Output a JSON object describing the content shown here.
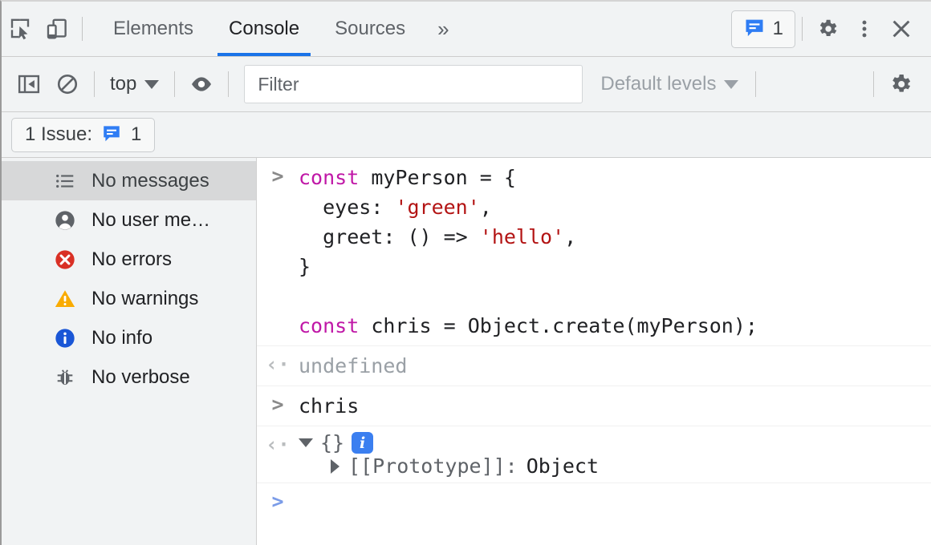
{
  "tabbar": {
    "inspect_icon": "inspect-cursor-icon",
    "device_icon": "device-toolbar-icon",
    "tabs": [
      {
        "label": "Elements",
        "active": false
      },
      {
        "label": "Console",
        "active": true
      },
      {
        "label": "Sources",
        "active": false
      }
    ],
    "more_tabs_label": "»",
    "issues_count": "1",
    "settings_icon": "gear-icon",
    "more_options_icon": "kebab-menu-icon",
    "close_icon": "close-icon"
  },
  "console_toolbar": {
    "sidebar_toggle_icon": "show-console-sidebar-icon",
    "clear_icon": "clear-console-icon",
    "context_label": "top",
    "eye_icon": "live-expressions-eye-icon",
    "filter_placeholder": "Filter",
    "filter_value": "",
    "levels_label": "Default levels",
    "settings_icon": "console-settings-gear-icon"
  },
  "issues_strip": {
    "label": "1 Issue:",
    "count": "1"
  },
  "sidebar": {
    "items": [
      {
        "label": "No messages",
        "icon": "list-icon",
        "selected": true
      },
      {
        "label": "No user me…",
        "icon": "user-icon",
        "selected": false
      },
      {
        "label": "No errors",
        "icon": "error-icon",
        "selected": false
      },
      {
        "label": "No warnings",
        "icon": "warning-icon",
        "selected": false
      },
      {
        "label": "No info",
        "icon": "info-icon",
        "selected": false
      },
      {
        "label": "No verbose",
        "icon": "verbose-bug-icon",
        "selected": false
      }
    ]
  },
  "console": {
    "input_marker": ">",
    "output_marker": "‹·",
    "entry1": {
      "line1_kw": "const",
      "line1_rest": " myPerson = {",
      "line2_pre": "  eyes: ",
      "line2_str": "'green'",
      "line2_post": ",",
      "line3_pre": "  greet: () => ",
      "line3_str": "'hello'",
      "line3_post": ",",
      "line4": "}",
      "line5": "",
      "line6_kw": "const",
      "line6_rest": " chris = Object.create(myPerson);"
    },
    "entry1_result": "undefined",
    "entry2": "chris",
    "entry2_result": {
      "brace": "{}",
      "info_badge": "i",
      "prototype_name": "[[Prototype]]:",
      "prototype_value": "Object"
    }
  },
  "colors": {
    "accent": "#1a73e8",
    "keyword": "#c018a7",
    "string": "#b31414",
    "error": "#d93025",
    "warning": "#f9ab00",
    "info": "#1a56d6",
    "toolbar_bg": "#f1f3f4"
  }
}
